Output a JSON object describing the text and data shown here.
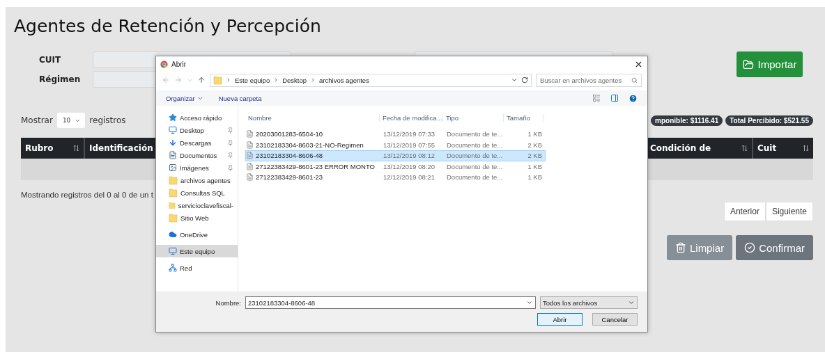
{
  "page": {
    "title": "Agentes de Retención y Percepción"
  },
  "form": {
    "fields": [
      {
        "label": "CUIT"
      },
      {
        "label": "Régimen"
      }
    ]
  },
  "import_button": {
    "label": "Importar"
  },
  "length_control": {
    "prefix": "Mostrar",
    "value": "10",
    "suffix": "registros"
  },
  "badges": [
    "mponible: $1116.41",
    "Total Percibido: $521.55"
  ],
  "table": {
    "columns": [
      {
        "label": "Rubro",
        "sort_icon": true
      },
      {
        "label": "Identificación",
        "sort_icon": false
      },
      {
        "label": "Condición de",
        "sort_icon": true
      },
      {
        "label": "Cuit",
        "sort_icon": true
      }
    ]
  },
  "info": "Mostrando registros del 0 al 0 de un t",
  "pagination": [
    "Anterior",
    "Siguiente"
  ],
  "actions": [
    {
      "label": "Limpiar",
      "kind": "clear"
    },
    {
      "label": "Confirmar",
      "kind": "confirm"
    }
  ],
  "dialog": {
    "title": "Abrir",
    "path": [
      "Este equipo",
      "Desktop",
      "archivos agentes"
    ],
    "search": {
      "placeholder": "Buscar en archivos agentes"
    },
    "toolbar": [
      "Organizar",
      "Nueva carpeta"
    ],
    "nav": [
      {
        "label": "Acceso rápido",
        "kind": "star",
        "selected": false,
        "children": [
          {
            "label": "Desktop",
            "kind": "desktop",
            "pinned": true,
            "selected": false
          },
          {
            "label": "Descargas",
            "kind": "download",
            "pinned": true,
            "selected": false
          },
          {
            "label": "Documentos",
            "kind": "document",
            "pinned": true,
            "selected": false
          },
          {
            "label": "Imágenes",
            "kind": "image",
            "pinned": true,
            "selected": false
          },
          {
            "label": "archivos agentes",
            "kind": "folder",
            "pinned": false,
            "selected": false
          },
          {
            "label": "Consultas SQL",
            "kind": "folder",
            "pinned": false,
            "selected": false
          },
          {
            "label": "servicioclavefiscal-",
            "kind": "folder",
            "pinned": false,
            "selected": false
          },
          {
            "label": "Sitio Web",
            "kind": "folder",
            "pinned": false,
            "selected": false
          }
        ]
      },
      {
        "label": "OneDrive",
        "kind": "cloud",
        "selected": false
      },
      {
        "label": "Este equipo",
        "kind": "computer",
        "selected": true
      },
      {
        "label": "Red",
        "kind": "network",
        "selected": false
      }
    ],
    "columns": [
      "Nombre",
      "Fecha de modifica...",
      "Tipo",
      "Tamaño"
    ],
    "files": [
      {
        "name": "20203001283-6504-10",
        "date": "13/12/2019 07:33",
        "type": "Documento de te...",
        "size": "1 KB",
        "selected": false
      },
      {
        "name": "23102183304-8603-21-NO-Regimen",
        "date": "13/12/2019 07:55",
        "type": "Documento de te...",
        "size": "2 KB",
        "selected": false
      },
      {
        "name": "23102183304-8606-48",
        "date": "13/12/2019 08:12",
        "type": "Documento de te...",
        "size": "2 KB",
        "selected": true
      },
      {
        "name": "27122383429-8601-23 ERROR MONTO",
        "date": "13/12/2019 08:20",
        "type": "Documento de te...",
        "size": "1 KB",
        "selected": false
      },
      {
        "name": "27122383429-8601-23",
        "date": "12/12/2019 08:21",
        "type": "Documento de te...",
        "size": "1 KB",
        "selected": false
      }
    ],
    "filename_label": "Nombre:",
    "filename": "23102183304-8606-48",
    "filter": "Todos los archivos",
    "buttons": [
      "Abrir",
      "Cancelar"
    ]
  }
}
